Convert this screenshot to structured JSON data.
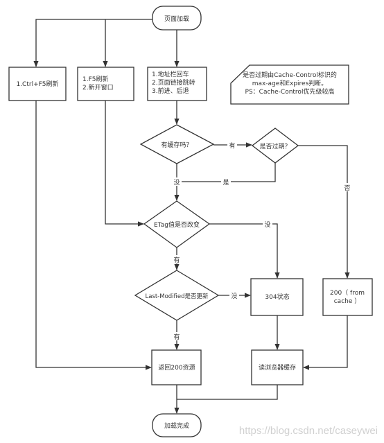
{
  "nodes": {
    "start": "页面加载",
    "ctrl_f5": "1.Ctrl+F5刷新",
    "f5_line1": "1.F5刷新",
    "f5_line2": "2.新开窗口",
    "addr_line1": "1.地址栏回车",
    "addr_line2": "2.页面链接跳转",
    "addr_line3": "3.前进、后退",
    "note_line1": "是否过期由Cache-Control标识的",
    "note_line2": "max-age和Expires判断。",
    "note_line3": "PS：Cache-Control优先级较高",
    "has_cache": "有缓存吗？",
    "expired": "是否过期？",
    "etag": "ETag值是否改变",
    "last_modified": "Last-Modified是否更新",
    "status_304": "304状态",
    "from_cache_line1": "200（ from",
    "from_cache_line2": "cache ）",
    "return_200": "返回200资源",
    "read_cache": "读浏览器缓存",
    "end": "加载完成"
  },
  "edges": {
    "has_yes": "有",
    "has_no": "没",
    "expired_yes": "是",
    "expired_no": "否",
    "etag_no": "没",
    "etag_yes": "有",
    "lm_no": "没",
    "lm_yes": "有"
  },
  "watermark": "https://blog.csdn.net/caseywei",
  "colors": {
    "stroke": "#333333",
    "watermark": "#d0d0d0"
  }
}
